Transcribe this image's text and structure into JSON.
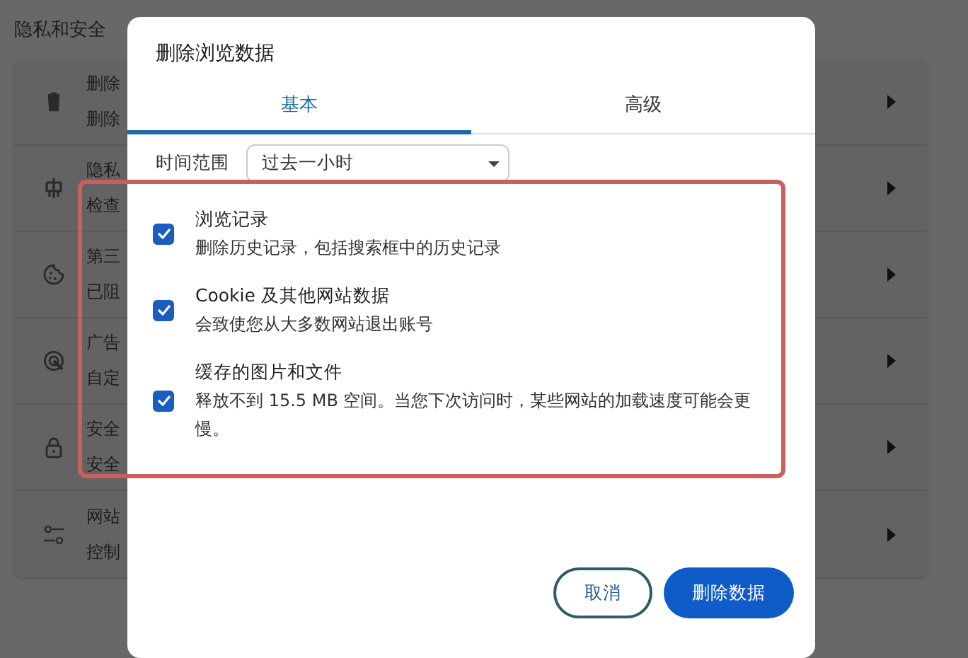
{
  "page": {
    "title": "隐私和安全",
    "rows": [
      {
        "title": "删除",
        "subtitle": "删除"
      },
      {
        "title": "隐私",
        "subtitle": "检查"
      },
      {
        "title": "第三",
        "subtitle": "已阻"
      },
      {
        "title": "广告",
        "subtitle": "自定"
      },
      {
        "title": "安全",
        "subtitle": "安全"
      },
      {
        "title": "网站",
        "subtitle": "控制"
      }
    ]
  },
  "dialog": {
    "title": "删除浏览数据",
    "tabs": [
      {
        "label": "基本",
        "selected": true
      },
      {
        "label": "高级",
        "selected": false
      }
    ],
    "time_range": {
      "label": "时间范围",
      "value": "过去一小时"
    },
    "options": [
      {
        "title": "浏览记录",
        "description": "删除历史记录，包括搜索框中的历史记录",
        "checked": true
      },
      {
        "title": "Cookie 及其他网站数据",
        "description": "会致使您从大多数网站退出账号",
        "checked": true
      },
      {
        "title": "缓存的图片和文件",
        "description": "释放不到 15.5 MB 空间。当您下次访问时，某些网站的加载速度可能会更慢。",
        "checked": true
      }
    ],
    "highlight": true,
    "buttons": [
      {
        "kind": "outline",
        "label": "取消"
      },
      {
        "kind": "primary",
        "label": "删除数据"
      }
    ]
  }
}
